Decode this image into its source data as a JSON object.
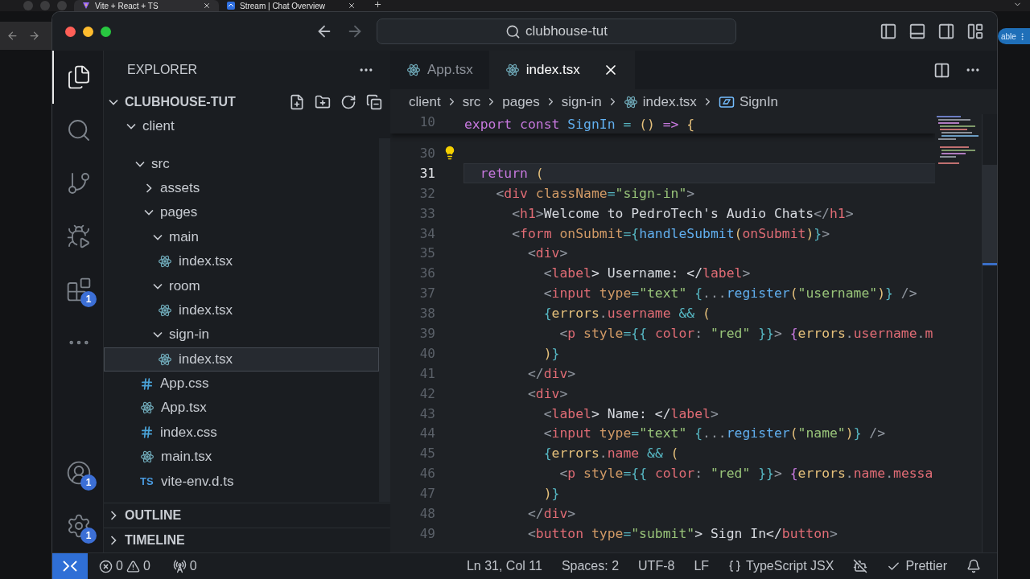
{
  "browser": {
    "tabs": [
      {
        "title": "Vite + React + TS",
        "selected": true,
        "kind": "vite"
      },
      {
        "title": "Stream | Chat Overview",
        "selected": false,
        "kind": "stream"
      }
    ],
    "side_button": "able"
  },
  "window": {
    "search": "clubhouse-tut"
  },
  "activity_bar": {
    "top": [
      {
        "kind": "explorer",
        "selected": true
      },
      {
        "kind": "search",
        "selected": false
      },
      {
        "kind": "source-control",
        "selected": false
      },
      {
        "kind": "run-debug",
        "selected": false
      },
      {
        "kind": "extensions",
        "selected": false,
        "badge": "1"
      },
      {
        "kind": "more",
        "selected": false
      }
    ],
    "bottom": [
      {
        "kind": "accounts",
        "selected": false,
        "badge": "1"
      },
      {
        "kind": "manage",
        "selected": false,
        "badge": "1"
      }
    ]
  },
  "sidebar": {
    "title": "EXPLORER",
    "project": "CLUBHOUSE-TUT",
    "project_expanded": true,
    "tree": [
      {
        "name": "client",
        "kind": "folder",
        "expanded": true,
        "children": [
          {
            "name": "src",
            "kind": "folder",
            "expanded": true,
            "children": [
              {
                "name": "assets",
                "kind": "folder",
                "expanded": false
              },
              {
                "name": "pages",
                "kind": "folder",
                "expanded": true,
                "children": [
                  {
                    "name": "main",
                    "kind": "folder",
                    "expanded": true,
                    "children": [
                      {
                        "name": "index.tsx",
                        "kind": "react",
                        "selected": false
                      }
                    ]
                  },
                  {
                    "name": "room",
                    "kind": "folder",
                    "expanded": true,
                    "children": [
                      {
                        "name": "index.tsx",
                        "kind": "react",
                        "selected": false
                      }
                    ]
                  },
                  {
                    "name": "sign-in",
                    "kind": "folder",
                    "expanded": true,
                    "children": [
                      {
                        "name": "index.tsx",
                        "kind": "react",
                        "selected": true
                      }
                    ]
                  }
                ]
              },
              {
                "name": "App.css",
                "kind": "css",
                "selected": false
              },
              {
                "name": "App.tsx",
                "kind": "react",
                "selected": false
              },
              {
                "name": "index.css",
                "kind": "css",
                "selected": false
              },
              {
                "name": "main.tsx",
                "kind": "react",
                "selected": false
              },
              {
                "name": "vite-env.d.ts",
                "kind": "ts",
                "badge": "TS",
                "selected": false
              }
            ]
          }
        ]
      }
    ],
    "sections": [
      {
        "title": "OUTLINE",
        "expanded": false
      },
      {
        "title": "TIMELINE",
        "expanded": false
      }
    ]
  },
  "editor": {
    "tabs": [
      {
        "label": "App.tsx",
        "selected": false
      },
      {
        "label": "index.tsx",
        "selected": true
      }
    ],
    "breadcrumb": [
      {
        "label": "client",
        "kind": "folder"
      },
      {
        "label": "src",
        "kind": "folder"
      },
      {
        "label": "pages",
        "kind": "folder"
      },
      {
        "label": "sign-in",
        "kind": "folder"
      },
      {
        "label": "index.tsx",
        "kind": "react"
      },
      {
        "label": "SignIn",
        "kind": "symbol"
      }
    ],
    "sticky_line": {
      "number": "10",
      "tokens": [
        {
          "text": "export",
          "kind": "kw"
        },
        {
          "text": " const",
          "kind": "kw"
        },
        {
          "text": " SignIn",
          "kind": "fn"
        },
        {
          "text": " =",
          "kind": "op"
        },
        {
          "text": " ()",
          "kind": "paren"
        },
        {
          "text": " =>",
          "kind": "kw"
        },
        {
          "text": " {",
          "kind": "paren"
        }
      ]
    },
    "lines": [
      {
        "number": "30",
        "current": false,
        "kind": "lightbulb"
      },
      {
        "number": "31",
        "current": true,
        "tokens": [
          {
            "text": "  return",
            "kind": "kw"
          },
          {
            "text": " (",
            "kind": "paren"
          }
        ]
      },
      {
        "number": "32",
        "current": false,
        "tokens": [
          {
            "text": "    <",
            "kind": "punct"
          },
          {
            "text": "div",
            "kind": "tag"
          },
          {
            "text": " className",
            "kind": "attr"
          },
          {
            "text": "=",
            "kind": "op"
          },
          {
            "text": "\"sign-in\"",
            "kind": "str"
          },
          {
            "text": ">",
            "kind": "punct"
          }
        ]
      },
      {
        "number": "33",
        "current": false,
        "tokens": [
          {
            "text": "      <",
            "kind": "punct"
          },
          {
            "text": "h1",
            "kind": "tag"
          },
          {
            "text": ">",
            "kind": "punct"
          },
          {
            "text": "Welcome to PedroTech's Audio Chats",
            "kind": "text"
          },
          {
            "text": "</",
            "kind": "punct"
          },
          {
            "text": "h1",
            "kind": "tag"
          },
          {
            "text": ">",
            "kind": "punct"
          }
        ]
      },
      {
        "number": "34",
        "current": false,
        "tokens": [
          {
            "text": "      <",
            "kind": "punct"
          },
          {
            "text": "form",
            "kind": "tag"
          },
          {
            "text": " onSubmit",
            "kind": "attr"
          },
          {
            "text": "=",
            "kind": "op"
          },
          {
            "text": "{",
            "kind": "brace"
          },
          {
            "text": "handleSubmit",
            "kind": "fn"
          },
          {
            "text": "(",
            "kind": "paren"
          },
          {
            "text": "onSubmit",
            "kind": "prop"
          },
          {
            "text": ")",
            "kind": "paren"
          },
          {
            "text": "}",
            "kind": "brace"
          },
          {
            "text": ">",
            "kind": "punct"
          }
        ]
      },
      {
        "number": "35",
        "current": false,
        "tokens": [
          {
            "text": "        <",
            "kind": "punct"
          },
          {
            "text": "div",
            "kind": "tag"
          },
          {
            "text": ">",
            "kind": "punct"
          }
        ]
      },
      {
        "number": "36",
        "current": false,
        "tokens": [
          {
            "text": "          <",
            "kind": "punct"
          },
          {
            "text": "label",
            "kind": "tag"
          },
          {
            "text": "> Username: </",
            "kind": "text"
          },
          {
            "text": "label",
            "kind": "tag"
          },
          {
            "text": ">",
            "kind": "punct"
          }
        ]
      },
      {
        "number": "37",
        "current": false,
        "tokens": [
          {
            "text": "          <",
            "kind": "punct"
          },
          {
            "text": "input",
            "kind": "tag"
          },
          {
            "text": " type",
            "kind": "attr"
          },
          {
            "text": "=",
            "kind": "op"
          },
          {
            "text": "\"text\"",
            "kind": "str"
          },
          {
            "text": " {",
            "kind": "brace"
          },
          {
            "text": "...",
            "kind": "punct"
          },
          {
            "text": "register",
            "kind": "fn"
          },
          {
            "text": "(",
            "kind": "paren"
          },
          {
            "text": "\"username\"",
            "kind": "str"
          },
          {
            "text": ")",
            "kind": "paren"
          },
          {
            "text": "}",
            "kind": "brace"
          },
          {
            "text": " />",
            "kind": "punct"
          }
        ]
      },
      {
        "number": "38",
        "current": false,
        "tokens": [
          {
            "text": "          {",
            "kind": "brace"
          },
          {
            "text": "errors",
            "kind": "var"
          },
          {
            "text": ".",
            "kind": "punct"
          },
          {
            "text": "username",
            "kind": "prop"
          },
          {
            "text": " &&",
            "kind": "op"
          },
          {
            "text": " (",
            "kind": "paren"
          }
        ]
      },
      {
        "number": "39",
        "current": false,
        "tokens": [
          {
            "text": "            <",
            "kind": "punct"
          },
          {
            "text": "p",
            "kind": "tag"
          },
          {
            "text": " style",
            "kind": "attr"
          },
          {
            "text": "=",
            "kind": "op"
          },
          {
            "text": "{{",
            "kind": "brace"
          },
          {
            "text": " color",
            "kind": "prop"
          },
          {
            "text": ":",
            "kind": "punct"
          },
          {
            "text": " \"red\"",
            "kind": "str"
          },
          {
            "text": " }}",
            "kind": "brace"
          },
          {
            "text": ">",
            "kind": "punct"
          },
          {
            "text": " {",
            "kind": "kw"
          },
          {
            "text": "errors",
            "kind": "var"
          },
          {
            "text": ".",
            "kind": "punct"
          },
          {
            "text": "username",
            "kind": "prop"
          },
          {
            "text": ".",
            "kind": "punct"
          },
          {
            "text": "m",
            "kind": "prop"
          }
        ]
      },
      {
        "number": "40",
        "current": false,
        "tokens": [
          {
            "text": "          )",
            "kind": "paren"
          },
          {
            "text": "}",
            "kind": "brace"
          }
        ]
      },
      {
        "number": "41",
        "current": false,
        "tokens": [
          {
            "text": "        </",
            "kind": "punct"
          },
          {
            "text": "div",
            "kind": "tag"
          },
          {
            "text": ">",
            "kind": "punct"
          }
        ]
      },
      {
        "number": "42",
        "current": false,
        "tokens": [
          {
            "text": "        <",
            "kind": "punct"
          },
          {
            "text": "div",
            "kind": "tag"
          },
          {
            "text": ">",
            "kind": "punct"
          }
        ]
      },
      {
        "number": "43",
        "current": false,
        "tokens": [
          {
            "text": "          <",
            "kind": "punct"
          },
          {
            "text": "label",
            "kind": "tag"
          },
          {
            "text": "> Name: </",
            "kind": "text"
          },
          {
            "text": "label",
            "kind": "tag"
          },
          {
            "text": ">",
            "kind": "punct"
          }
        ]
      },
      {
        "number": "44",
        "current": false,
        "tokens": [
          {
            "text": "          <",
            "kind": "punct"
          },
          {
            "text": "input",
            "kind": "tag"
          },
          {
            "text": " type",
            "kind": "attr"
          },
          {
            "text": "=",
            "kind": "op"
          },
          {
            "text": "\"text\"",
            "kind": "str"
          },
          {
            "text": " {",
            "kind": "brace"
          },
          {
            "text": "...",
            "kind": "punct"
          },
          {
            "text": "register",
            "kind": "fn"
          },
          {
            "text": "(",
            "kind": "paren"
          },
          {
            "text": "\"name\"",
            "kind": "str"
          },
          {
            "text": ")",
            "kind": "paren"
          },
          {
            "text": "}",
            "kind": "brace"
          },
          {
            "text": " />",
            "kind": "punct"
          }
        ]
      },
      {
        "number": "45",
        "current": false,
        "tokens": [
          {
            "text": "          {",
            "kind": "brace"
          },
          {
            "text": "errors",
            "kind": "var"
          },
          {
            "text": ".",
            "kind": "punct"
          },
          {
            "text": "name",
            "kind": "prop"
          },
          {
            "text": " &&",
            "kind": "op"
          },
          {
            "text": " (",
            "kind": "paren"
          }
        ]
      },
      {
        "number": "46",
        "current": false,
        "tokens": [
          {
            "text": "            <",
            "kind": "punct"
          },
          {
            "text": "p",
            "kind": "tag"
          },
          {
            "text": " style",
            "kind": "attr"
          },
          {
            "text": "=",
            "kind": "op"
          },
          {
            "text": "{{",
            "kind": "brace"
          },
          {
            "text": " color",
            "kind": "prop"
          },
          {
            "text": ":",
            "kind": "punct"
          },
          {
            "text": " \"red\"",
            "kind": "str"
          },
          {
            "text": " }}",
            "kind": "brace"
          },
          {
            "text": ">",
            "kind": "punct"
          },
          {
            "text": " {",
            "kind": "kw"
          },
          {
            "text": "errors",
            "kind": "var"
          },
          {
            "text": ".",
            "kind": "punct"
          },
          {
            "text": "name",
            "kind": "prop"
          },
          {
            "text": ".",
            "kind": "punct"
          },
          {
            "text": "messa",
            "kind": "prop"
          }
        ]
      },
      {
        "number": "47",
        "current": false,
        "tokens": [
          {
            "text": "          )",
            "kind": "paren"
          },
          {
            "text": "}",
            "kind": "brace"
          }
        ]
      },
      {
        "number": "48",
        "current": false,
        "tokens": [
          {
            "text": "        </",
            "kind": "punct"
          },
          {
            "text": "div",
            "kind": "tag"
          },
          {
            "text": ">",
            "kind": "punct"
          }
        ]
      },
      {
        "number": "49",
        "current": false,
        "tokens": [
          {
            "text": "        <",
            "kind": "punct"
          },
          {
            "text": "button",
            "kind": "tag"
          },
          {
            "text": " type",
            "kind": "attr"
          },
          {
            "text": "=",
            "kind": "op"
          },
          {
            "text": "\"submit\"",
            "kind": "str"
          },
          {
            "text": "> Sign In</",
            "kind": "text"
          },
          {
            "text": "button",
            "kind": "tag"
          },
          {
            "text": ">",
            "kind": "punct"
          }
        ]
      }
    ]
  },
  "status_bar": {
    "errors": "0",
    "warnings": "0",
    "ports": "0",
    "items": [
      {
        "kind": "text",
        "label": "Ln 31, Col 11"
      },
      {
        "kind": "text",
        "label": "Spaces: 2"
      },
      {
        "kind": "text",
        "label": "UTF-8"
      },
      {
        "kind": "text",
        "label": "LF"
      },
      {
        "kind": "language",
        "label": "TypeScript JSX"
      },
      {
        "kind": "copilot"
      },
      {
        "kind": "formatter",
        "label": "Prettier"
      },
      {
        "kind": "bell"
      }
    ]
  }
}
